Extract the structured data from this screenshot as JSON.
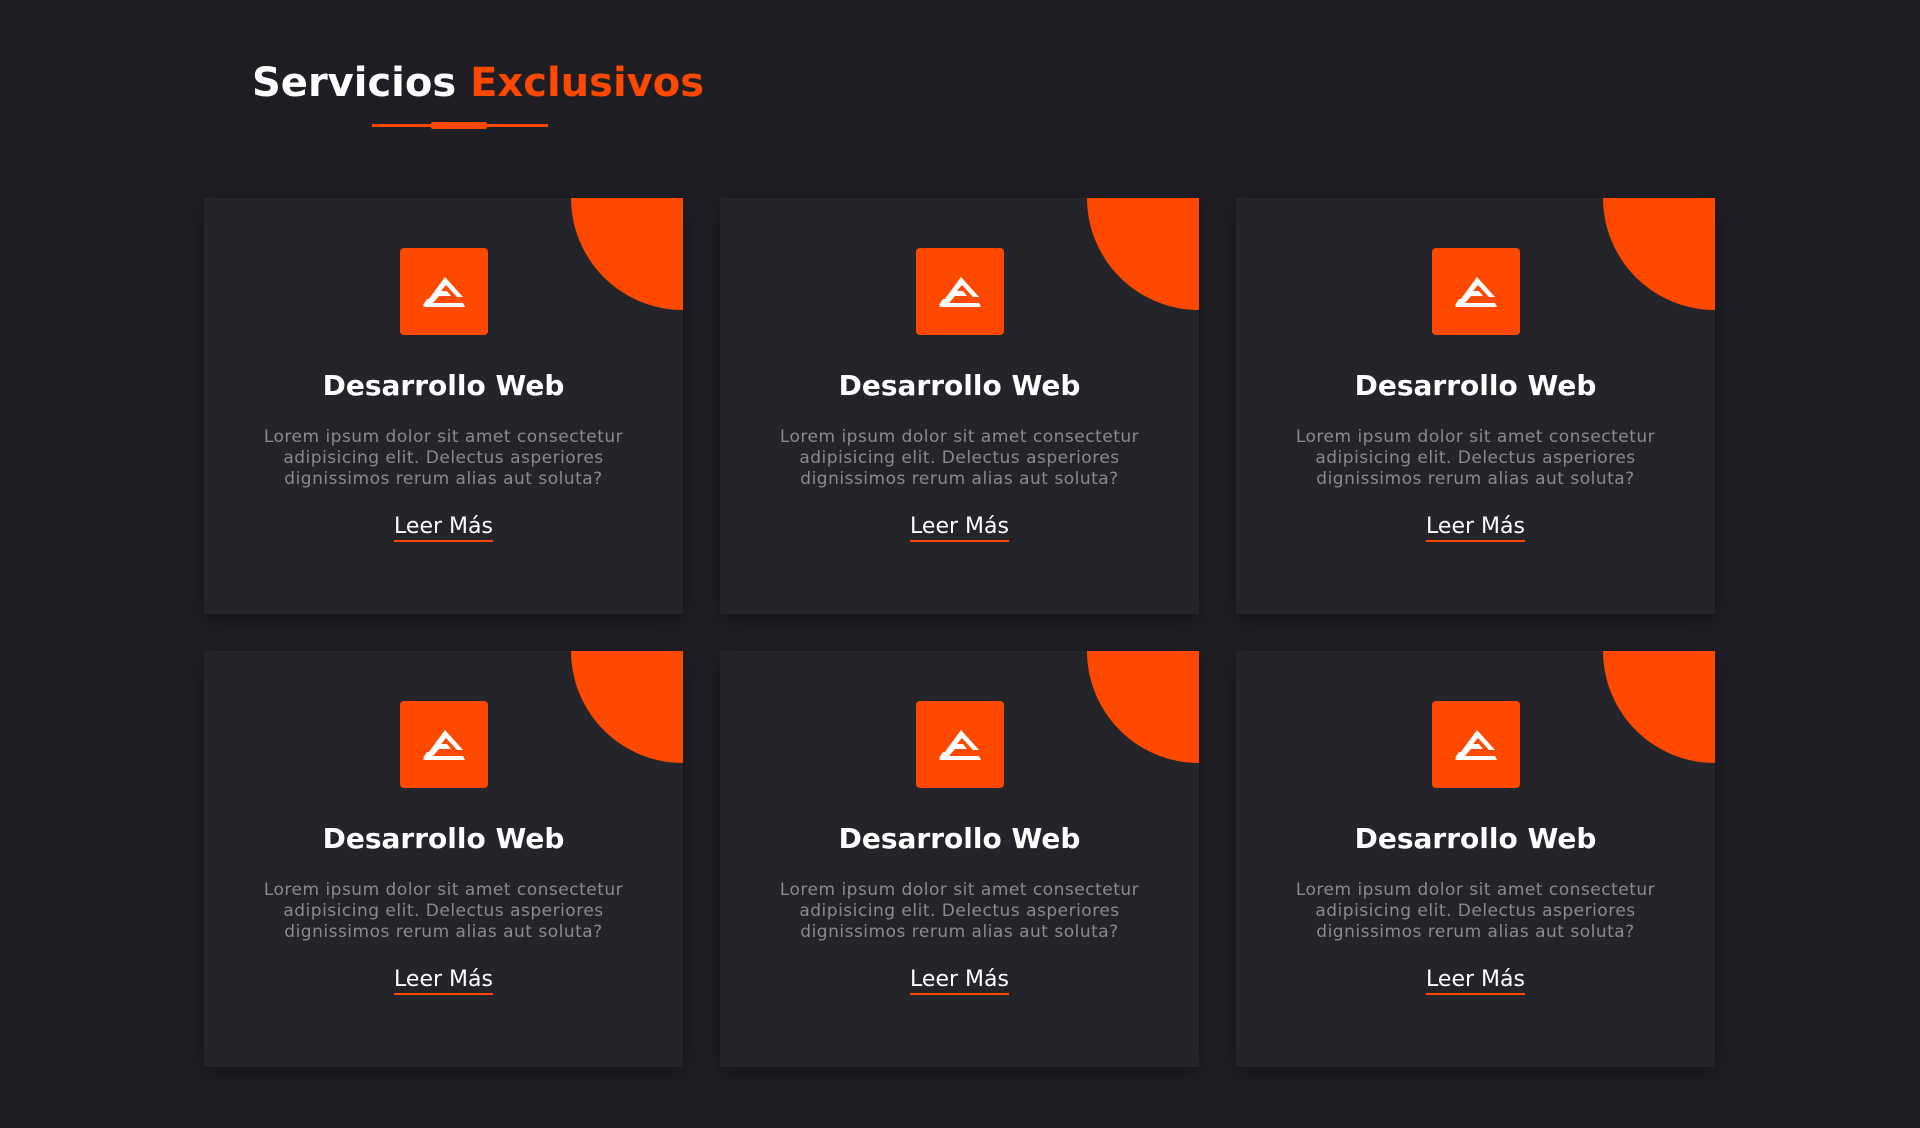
{
  "header": {
    "title_white": "Servicios",
    "title_accent": "Exclusivos"
  },
  "colors": {
    "background": "#1f1e24",
    "card": "#24252a",
    "accent": "#ff4800",
    "text": "#ffffff",
    "muted_text": "#8a8a8f"
  },
  "cards": [
    {
      "icon": "brand-logo-icon",
      "title": "Desarrollo Web",
      "text": "Lorem ipsum dolor sit amet consectetur adipisicing elit. Delectus asperiores dignissimos rerum alias aut soluta?",
      "link": "Leer Más"
    },
    {
      "icon": "brand-logo-icon",
      "title": "Desarrollo Web",
      "text": "Lorem ipsum dolor sit amet consectetur adipisicing elit. Delectus asperiores dignissimos rerum alias aut soluta?",
      "link": "Leer Más"
    },
    {
      "icon": "brand-logo-icon",
      "title": "Desarrollo Web",
      "text": "Lorem ipsum dolor sit amet consectetur adipisicing elit. Delectus asperiores dignissimos rerum alias aut soluta?",
      "link": "Leer Más"
    },
    {
      "icon": "brand-logo-icon",
      "title": "Desarrollo Web",
      "text": "Lorem ipsum dolor sit amet consectetur adipisicing elit. Delectus asperiores dignissimos rerum alias aut soluta?",
      "link": "Leer Más"
    },
    {
      "icon": "brand-logo-icon",
      "title": "Desarrollo Web",
      "text": "Lorem ipsum dolor sit amet consectetur adipisicing elit. Delectus asperiores dignissimos rerum alias aut soluta?",
      "link": "Leer Más"
    },
    {
      "icon": "brand-logo-icon",
      "title": "Desarrollo Web",
      "text": "Lorem ipsum dolor sit amet consectetur adipisicing elit. Delectus asperiores dignissimos rerum alias aut soluta?",
      "link": "Leer Más"
    }
  ]
}
